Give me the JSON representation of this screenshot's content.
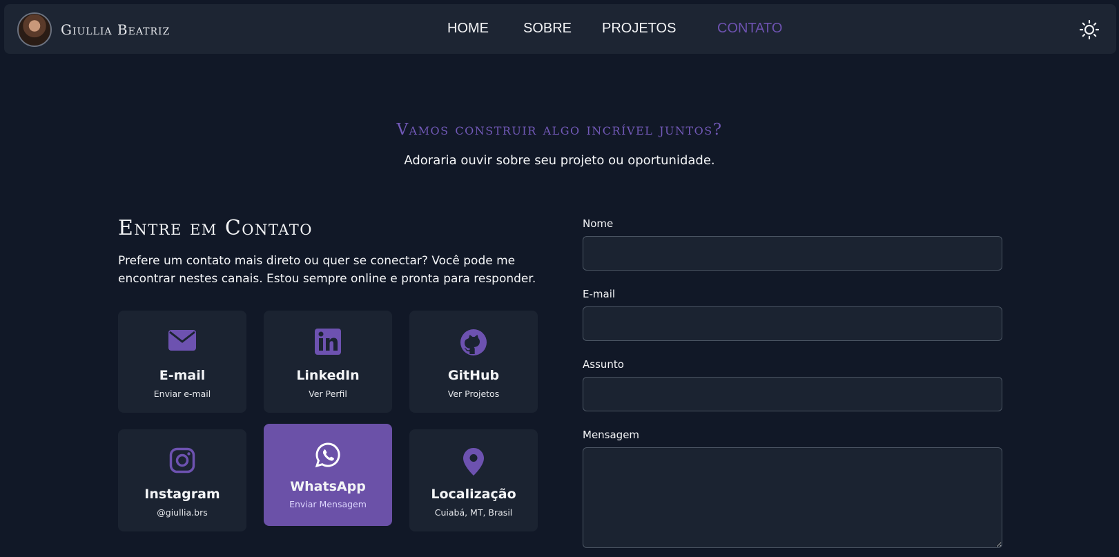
{
  "brand": {
    "name": "Giullia Beatriz"
  },
  "nav": {
    "items": [
      {
        "label": "HOME"
      },
      {
        "label": "SOBRE"
      },
      {
        "label": "PROJETOS"
      },
      {
        "label": "CONTATO"
      }
    ],
    "active": "CONTATO",
    "theme_icon": "sun-icon"
  },
  "hero": {
    "kicker": "Vamos construir algo incrível juntos?",
    "subtitle": "Adoraria ouvir sobre seu projeto ou oportunidade."
  },
  "contact": {
    "title": "Entre em Contato",
    "description": "Prefere um contato mais direto ou quer se conectar? Você pode me encontrar nestes canais. Estou sempre online e pronta para responder.",
    "cards": [
      {
        "icon": "envelope-icon",
        "title": "E-mail",
        "subtitle": "Enviar e-mail"
      },
      {
        "icon": "linkedin-icon",
        "title": "LinkedIn",
        "subtitle": "Ver Perfil"
      },
      {
        "icon": "github-icon",
        "title": "GitHub",
        "subtitle": "Ver Projetos"
      },
      {
        "icon": "instagram-icon",
        "title": "Instagram",
        "subtitle": "@giullia.brs"
      },
      {
        "icon": "whatsapp-icon",
        "title": "WhatsApp",
        "subtitle": "Enviar Mensagem"
      },
      {
        "icon": "map-pin-icon",
        "title": "Localização",
        "subtitle": "Cuiabá, MT, Brasil"
      }
    ]
  },
  "form": {
    "name_label": "Nome",
    "name_value": "",
    "email_label": "E-mail",
    "email_value": "",
    "subject_label": "Assunto",
    "subject_value": "",
    "message_label": "Mensagem",
    "message_value": ""
  },
  "colors": {
    "background": "#111827",
    "surface": "#1b2331",
    "accent": "#6d52b0",
    "accent_card": "#6b51a8",
    "text": "#f3f4f6"
  }
}
